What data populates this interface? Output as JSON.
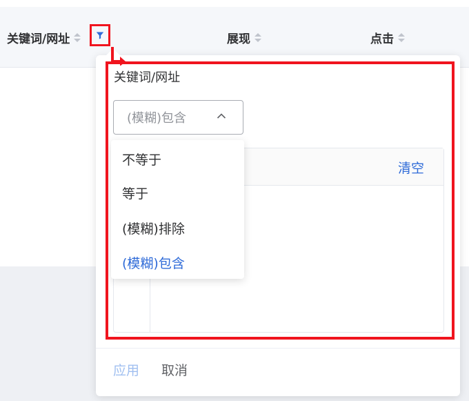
{
  "table": {
    "columns": [
      {
        "label": "关键词/网址"
      },
      {
        "label": "展现"
      },
      {
        "label": "点击"
      }
    ]
  },
  "filter_popover": {
    "title": "关键词/网址",
    "match_select": {
      "value": "(模糊)包含",
      "options": [
        "不等于",
        "等于",
        "(模糊)排除",
        "(模糊)包含"
      ],
      "selected_index": 3
    },
    "list_panel": {
      "clear_label": "清空"
    },
    "footer": {
      "apply_label": "应用",
      "cancel_label": "取消"
    }
  },
  "colors": {
    "accent": "#2f6bd8",
    "annotation": "#f0141e",
    "header_bg": "#f5f7fa"
  }
}
